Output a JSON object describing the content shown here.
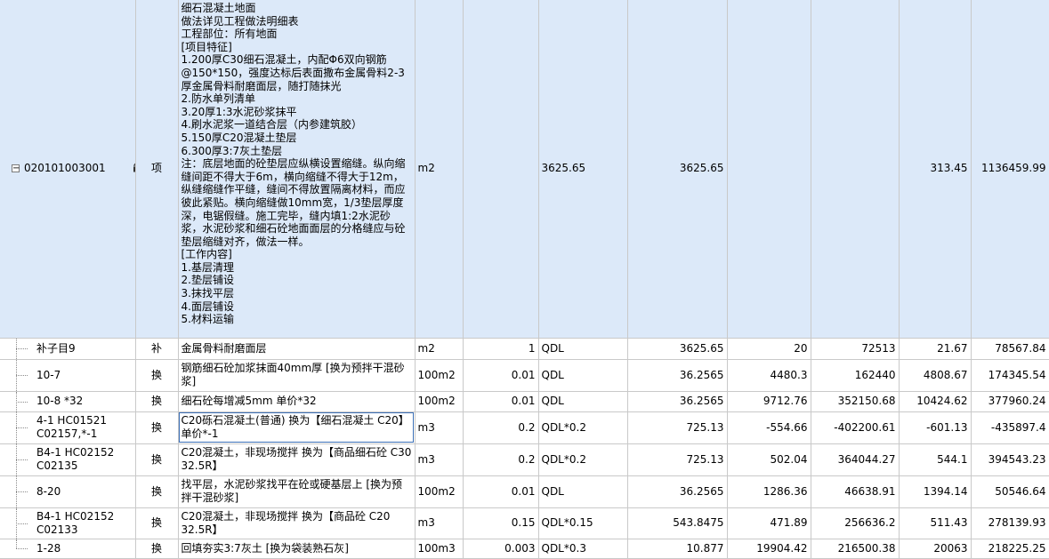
{
  "main": {
    "code": "020101003001",
    "type": "项",
    "description_lines": [
      "细石混凝土地面",
      "做法详见工程做法明细表",
      "工程部位：所有地面",
      "[项目特征]",
      "1.200厚C30细石混凝土，内配Φ6双向钢筋@150*150，强度达标后表面撒布金属骨料2-3厚金属骨料耐磨面层，随打随抹光",
      "2.防水单列清单",
      "3.20厚1:3水泥砂浆抹平",
      "4.刷水泥浆一道结合层（内参建筑胶）",
      "5.150厚C20混凝土垫层",
      "6.300厚3:7灰土垫层",
      "注：底层地面的砼垫层应纵横设置缩缝。纵向缩缝间距不得大于6m，横向缩缝不得大于12m，纵缝缩缝作平缝，缝间不得放置隔离材料，而应彼此紧贴。横向缩缝做10mm宽，1/3垫层厚度深，电锯假缝。施工完毕，缝内填1:2水泥砂浆，水泥砂浆和细石砼地面面层的分格缝应与砼垫层缩缝对齐，做法一样。",
      "[工作内容]",
      "1.基层清理",
      "2.垫层铺设",
      "3.抹找平层",
      "4.面层铺设",
      "5.材料运输"
    ],
    "unit": "m2",
    "factor": "",
    "expr": "3625.65",
    "qty": "3625.65",
    "price": "",
    "total": "",
    "unit_total": "313.45",
    "sum": "1136459.99"
  },
  "rows": [
    {
      "code": "补子目9",
      "type": "补",
      "name": "金属骨料耐磨面层",
      "unit": "m2",
      "factor": "1",
      "expr": "QDL",
      "qty": "3625.65",
      "price": "20",
      "total": "72513",
      "unit_total": "21.67",
      "sum": "78567.84"
    },
    {
      "code": "10-7",
      "type": "换",
      "name": "钢筋细石砼加浆抹面40mm厚  [换为预拌干混砂浆]",
      "unit": "100m2",
      "factor": "0.01",
      "expr": "QDL",
      "qty": "36.2565",
      "price": "4480.3",
      "total": "162440",
      "unit_total": "4808.67",
      "sum": "174345.54"
    },
    {
      "code": "10-8 *32",
      "type": "换",
      "name": "细石砼每增减5mm  单价*32",
      "unit": "100m2",
      "factor": "0.01",
      "expr": "QDL",
      "qty": "36.2565",
      "price": "9712.76",
      "total": "352150.68",
      "unit_total": "10424.62",
      "sum": "377960.24"
    },
    {
      "code": "4-1 HC01521 C02157,*-1",
      "type": "换",
      "name": "C20砾石混凝土(普通)  换为【细石混凝土 C20】  单价*-1",
      "unit": "m3",
      "factor": "0.2",
      "expr": "QDL*0.2",
      "qty": "725.13",
      "price": "-554.66",
      "total": "-402200.61",
      "unit_total": "-601.13",
      "sum": "-435897.4"
    },
    {
      "code": "B4-1 HC02152 C02135",
      "type": "换",
      "name": "C20混凝土，非现场搅拌  换为【商品细石砼 C30 32.5R】",
      "unit": "m3",
      "factor": "0.2",
      "expr": "QDL*0.2",
      "qty": "725.13",
      "price": "502.04",
      "total": "364044.27",
      "unit_total": "544.1",
      "sum": "394543.23"
    },
    {
      "code": "8-20",
      "type": "换",
      "name": "找平层，水泥砂浆找平在砼或硬基层上  [换为预拌干混砂浆]",
      "unit": "100m2",
      "factor": "0.01",
      "expr": "QDL",
      "qty": "36.2565",
      "price": "1286.36",
      "total": "46638.91",
      "unit_total": "1394.14",
      "sum": "50546.64"
    },
    {
      "code": "B4-1 HC02152 C02133",
      "type": "换",
      "name": "C20混凝土，非现场搅拌  换为【商品砼 C20 32.5R】",
      "unit": "m3",
      "factor": "0.15",
      "expr": "QDL*0.15",
      "qty": "543.8475",
      "price": "471.89",
      "total": "256636.2",
      "unit_total": "511.43",
      "sum": "278139.93"
    },
    {
      "code": "1-28",
      "type": "换",
      "name": "回填夯实3:7灰土  [换为袋装熟石灰]",
      "unit": "100m3",
      "factor": "0.003",
      "expr": "QDL*0.3",
      "qty": "10.877",
      "price": "19904.42",
      "total": "216500.38",
      "unit_total": "20063",
      "sum": "218225.25"
    }
  ],
  "icons": {
    "expander": "minus-square-icon",
    "lock": "lock-icon"
  },
  "colors": {
    "selected_row_bg": "#dce9f9",
    "grid_line": "#c9c9c9",
    "selection_border": "#3b6fb6"
  }
}
